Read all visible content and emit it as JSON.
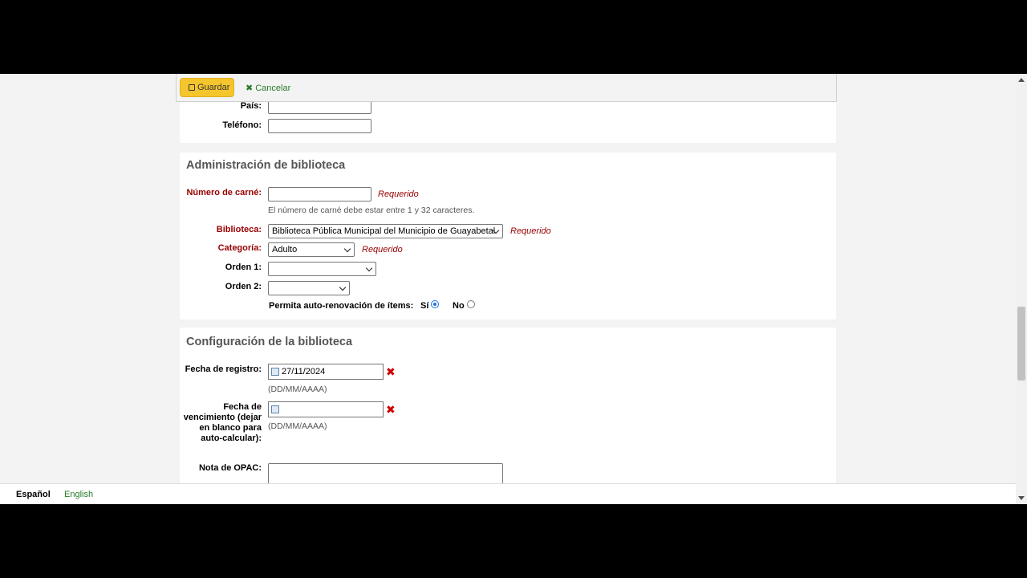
{
  "toolbar": {
    "save_label": "Guardar",
    "cancel_label": "Cancelar"
  },
  "contact": {
    "country_label": "País:",
    "phone_label": "Teléfono:"
  },
  "admin": {
    "heading": "Administración de biblioteca",
    "card_label": "Número de carné:",
    "card_hint": "El número de carné debe estar entre 1 y 32 caracteres.",
    "library_label": "Biblioteca:",
    "library_value": "Biblioteca Pública Municipal del Municipio de Guayabetal",
    "category_label": "Categoría:",
    "category_value": "Adulto",
    "sort1_label": "Orden 1:",
    "sort2_label": "Orden 2:",
    "required_text": "Requerido",
    "autorenew_label": "Permita auto-renovación de ítems:",
    "yes_label": "Sí",
    "no_label": "No",
    "autorenew_selected": "yes"
  },
  "config": {
    "heading": "Configuración de la biblioteca",
    "reg_date_label": "Fecha de registro:",
    "reg_date_value": "27/11/2024",
    "date_format": "(DD/MM/AAAA)",
    "expiry_label": "Fecha de vencimiento (dejar en blanco para auto-calcular):",
    "expiry_value": "",
    "opac_note_label": "Nota de OPAC:"
  },
  "footer": {
    "current_lang": "Español",
    "other_lang": "English"
  }
}
